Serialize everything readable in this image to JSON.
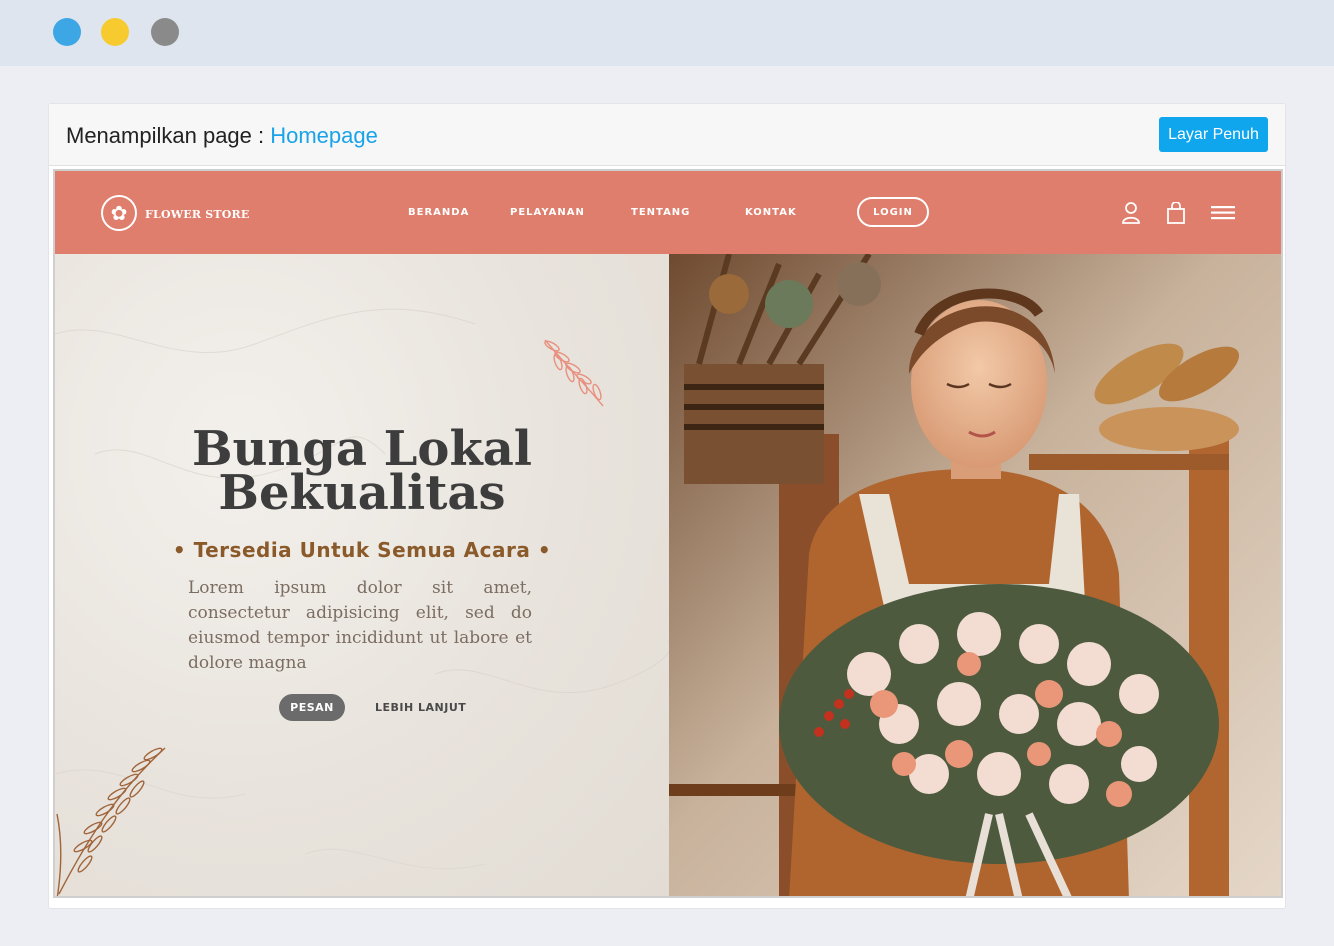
{
  "window": {
    "controls": [
      "close-dot",
      "minimize-dot",
      "maximize-dot"
    ]
  },
  "panel": {
    "title_prefix": "Menampilkan page : ",
    "page_name": "Homepage",
    "fullscreen_label": "Layar Penuh"
  },
  "site": {
    "brand": "FLOWER STORE",
    "nav": [
      "BERANDA",
      "PELAYANAN",
      "TENTANG",
      "KONTAK"
    ],
    "login_label": "LOGIN",
    "icons": [
      "user-icon",
      "shopping-bag-icon",
      "menu-icon"
    ],
    "colors": {
      "nav_bg": "#df7e6c",
      "accent": "#8b5a2b"
    }
  },
  "hero": {
    "title_line1": "Bunga Lokal",
    "title_line2": "Bekualitas",
    "subtitle": "• Tersedia Untuk Semua Acara •",
    "body": "Lorem ipsum dolor sit amet, consectetur adipisicing elit, sed do eiusmod tempor incididunt ut labore et dolore magna",
    "order_label": "PESAN",
    "more_label": "LEBIH LANJUT"
  }
}
